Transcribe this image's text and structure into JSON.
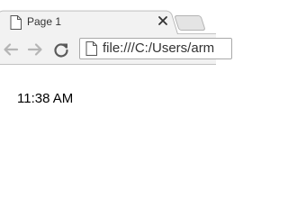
{
  "tab": {
    "title": "Page 1",
    "icon": "page-icon",
    "close_icon": "close-icon"
  },
  "toolbar": {
    "back_icon": "back-arrow-icon",
    "forward_icon": "forward-arrow-icon",
    "reload_icon": "reload-icon"
  },
  "omnibox": {
    "url": "file:///C:/Users/arm",
    "icon": "page-icon"
  },
  "page": {
    "time": "11:38 AM"
  },
  "colors": {
    "tab_bg": "#f2f2f2",
    "toolbar_bg": "#f2f2f2",
    "new_tab_bg": "#e4e4e4",
    "icon_gray": "#5a5a5a",
    "disabled_icon": "#b5b5b5"
  }
}
